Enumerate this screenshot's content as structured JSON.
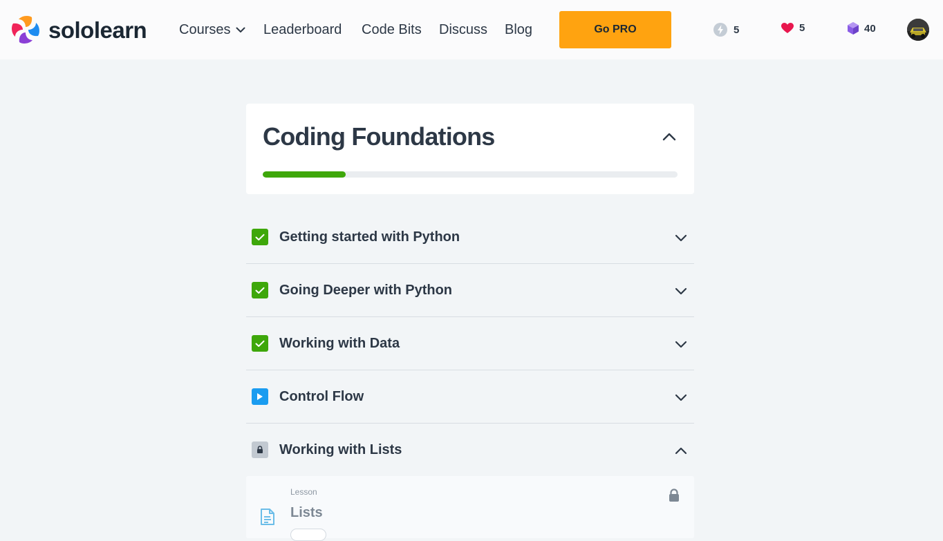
{
  "header": {
    "logo_text": "sololearn",
    "nav": {
      "courses": "Courses",
      "leaderboard": "Leaderboard",
      "code_bits": "Code Bits",
      "discuss": "Discuss",
      "blog": "Blog"
    },
    "go_pro_label": "Go PRO",
    "stats": {
      "bolt": "5",
      "hearts": "5",
      "gems": "40"
    },
    "icons": {
      "bolt": "lightning-bolt-icon",
      "heart": "heart-icon",
      "gem": "gem-icon",
      "dropdown": "chevron-down-icon"
    }
  },
  "course": {
    "title": "Coding Foundations",
    "progress": 0.2,
    "expanded": true
  },
  "modules": [
    {
      "title": "Getting started with Python",
      "status": "completed",
      "expanded": false
    },
    {
      "title": "Going Deeper with Python",
      "status": "completed",
      "expanded": false
    },
    {
      "title": "Working with Data",
      "status": "completed",
      "expanded": false
    },
    {
      "title": "Control Flow",
      "status": "in-progress",
      "expanded": false
    },
    {
      "title": "Working with Lists",
      "status": "locked",
      "expanded": true
    }
  ],
  "lesson": {
    "type_label": "Lesson",
    "title": "Lists",
    "locked": true
  },
  "colors": {
    "accent_green": "#3ea70b",
    "accent_blue": "#1a9cf0",
    "go_pro": "#ffa310",
    "heart": "#e8174e",
    "gem": "#8a5ce6"
  }
}
